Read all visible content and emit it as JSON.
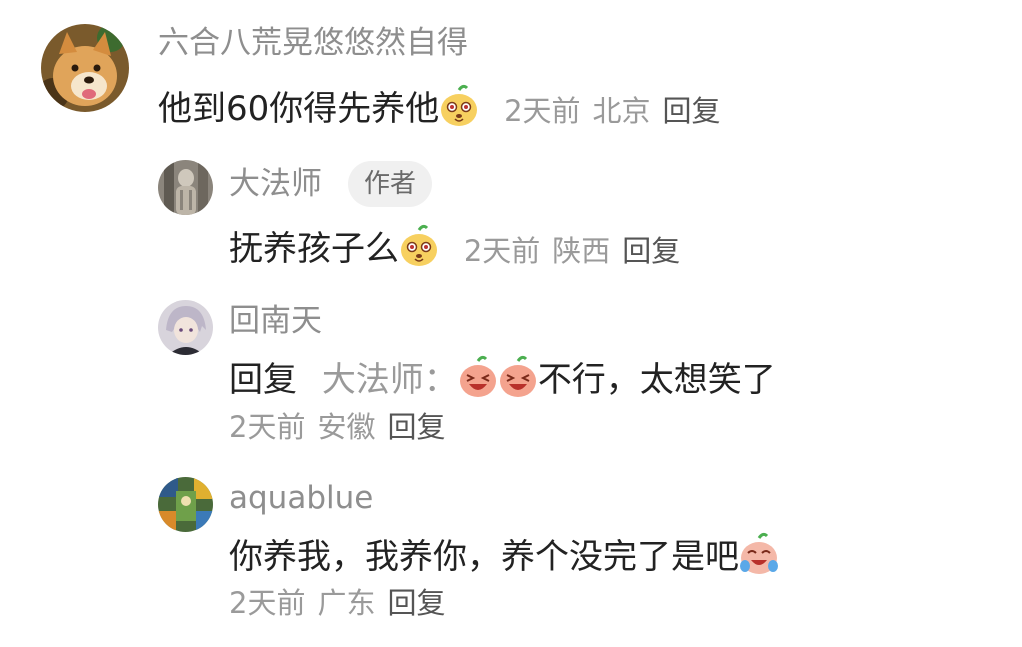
{
  "comment": {
    "user": "六合八荒晃悠悠然自得",
    "content": "他到60你得先养他",
    "emoji": "dog-face",
    "time": "2天前",
    "location": "北京",
    "reply_label": "回复"
  },
  "replies": [
    {
      "user": "大法师",
      "badge": "作者",
      "content": "抚养孩子么",
      "emoji": "dog-face",
      "time": "2天前",
      "location": "陕西",
      "reply_label": "回复"
    },
    {
      "user": "回南天",
      "prefix": "回复",
      "reply_to": "大法师：",
      "emoji": "laughing-face",
      "content": "不行，太想笑了",
      "time": "2天前",
      "location": "安徽",
      "reply_label": "回复"
    },
    {
      "user": "aquablue",
      "content": "你养我，我养你，养个没完了是吧",
      "emoji": "crying-laughing-face",
      "time": "2天前",
      "location": "广东",
      "reply_label": "回复"
    }
  ],
  "colors": {
    "username": "#8e8e8e",
    "content": "#222222",
    "meta": "#9a9a9a",
    "reply_link": "#555555",
    "badge_bg": "#f0f0f0"
  }
}
